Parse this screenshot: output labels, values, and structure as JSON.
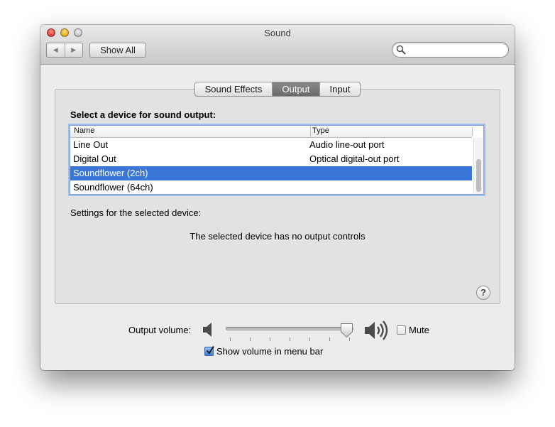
{
  "window": {
    "title": "Sound"
  },
  "toolbar": {
    "back_icon": "back-arrow-icon",
    "forward_icon": "forward-arrow-icon",
    "show_all_label": "Show All",
    "search_placeholder": "",
    "search_value": ""
  },
  "tabs": [
    {
      "label": "Sound Effects",
      "selected": false
    },
    {
      "label": "Output",
      "selected": true
    },
    {
      "label": "Input",
      "selected": false
    }
  ],
  "output": {
    "select_label": "Select a device for sound output:",
    "table": {
      "columns": [
        "Name",
        "Type"
      ],
      "rows": [
        {
          "name": "Line Out",
          "type": "Audio line-out port",
          "selected": false
        },
        {
          "name": "Digital Out",
          "type": "Optical digital-out port",
          "selected": false
        },
        {
          "name": "Soundflower (2ch)",
          "type": "",
          "selected": true
        },
        {
          "name": "Soundflower (64ch)",
          "type": "",
          "selected": false
        }
      ]
    },
    "settings_label": "Settings for the selected device:",
    "no_controls_message": "The selected device has no output controls",
    "help_label": "?"
  },
  "volume": {
    "label": "Output volume:",
    "level_fraction": 0.97,
    "tick_count": 7,
    "mute_label": "Mute",
    "mute_checked": false,
    "show_in_menu_bar_label": "Show volume in menu bar",
    "show_in_menu_bar_checked": true
  },
  "colors": {
    "selection": "#3a75d8",
    "selected_tab": "#6a6a6a",
    "focus_ring": "#9fc0ef"
  }
}
